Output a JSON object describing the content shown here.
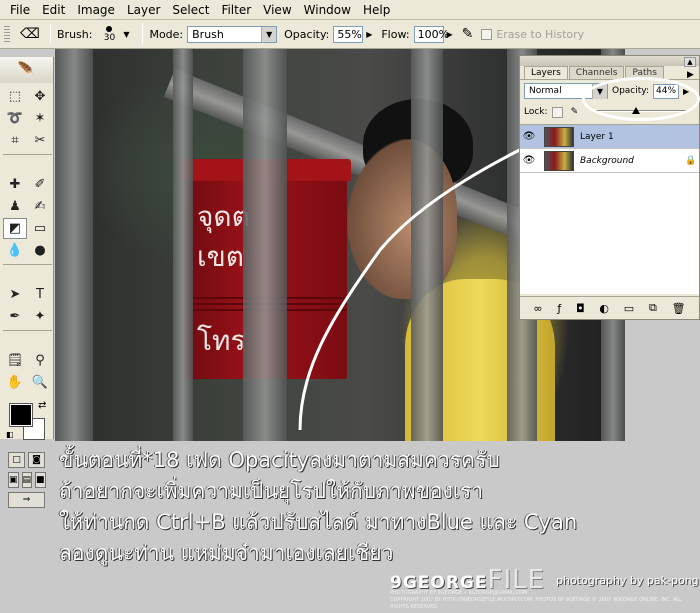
{
  "menu": [
    "File",
    "Edit",
    "Image",
    "Layer",
    "Select",
    "Filter",
    "View",
    "Window",
    "Help"
  ],
  "options_bar": {
    "brush_label": "Brush:",
    "brush_size": "30",
    "mode_label": "Mode:",
    "mode_value": "Brush",
    "opacity_label": "Opacity:",
    "opacity_value": "55%",
    "flow_label": "Flow:",
    "flow_value": "100%",
    "erase_history_label": "Erase to History"
  },
  "canvas": {
    "postbox_lines": [
      "จุดต",
      "เขต",
      "โทร"
    ]
  },
  "layers_panel": {
    "tabs": [
      "Layers",
      "Channels",
      "Paths"
    ],
    "blend_mode": "Normal",
    "opacity_label": "Opacity:",
    "opacity_value": "44%",
    "opacity_fraction": 0.44,
    "lock_label": "Lock:",
    "layers": [
      {
        "name": "Layer 1",
        "selected": true
      },
      {
        "name": "Background",
        "selected": false,
        "locked": true
      }
    ]
  },
  "caption": [
    "ขั้นตอนที่*18 เฟด Opacityลงมาตามสมควรครับ",
    "ถ้าอยากจะเพิ่มความเป็นยุโรปให้กับภาพของเรา",
    "ให้ท่านกด Ctrl+B แล้วปรับสไลด์ มาทางBlue และ Cyan",
    "ลองดูนะท่าน แหม่มจ๋ามาเองเลยเชียว"
  ],
  "credits": {
    "logo_main": "9GEORGE",
    "logo_suffix": "FILE",
    "photographer": "photography by pak-pong",
    "fine_print_1": "PHOTOGRAPHY BY 9GEORGE  •  9GEORGE@GMAIL.COM",
    "fine_print_2": "COPYRIGHT 2007 BY HTTP://9GEORGEFILE.MULTIPLY.COM. PHOTOS BY 9GEORGE  © 2007 9GEORGE ONLINE, INC. ALL RIGHTS RESERVED."
  },
  "colors": {
    "ui_face": "#ece9d8",
    "selected_layer": "#b1c3e0",
    "foreground": "#000000",
    "background": "#ffffff",
    "postbox_red": "#9b1218"
  }
}
